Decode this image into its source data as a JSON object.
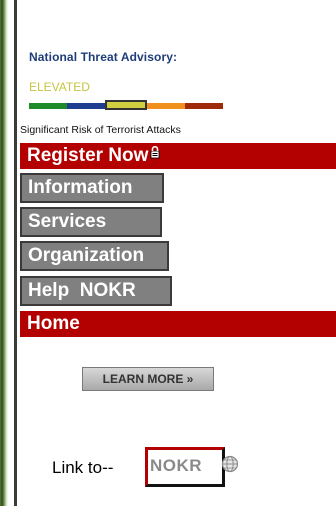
{
  "advisory": {
    "title": "National Threat Advisory:",
    "level": "ELEVATED",
    "description": "Significant Risk of Terrorist Attacks",
    "scale_colors": [
      "#1f8a2a",
      "#1f3d8f",
      "#cfcf40",
      "#f0901e",
      "#9e2a0a"
    ],
    "active_index": 2
  },
  "nav": {
    "register": "Register Now",
    "information": "Information",
    "services": "Services",
    "organization": "Organization",
    "help": "Help  NOKR",
    "home": "Home"
  },
  "learn_more": {
    "label": "LEARN MORE »"
  },
  "footer": {
    "link_text": "Link to--",
    "logo_text": "NOKR"
  },
  "colors": {
    "nav_red": "#b30000",
    "nav_gray": "#808080",
    "advisory_blue": "#1f3d78",
    "elevated_yellow": "#c7c542"
  },
  "icons": {
    "register": "lock-icon",
    "logo": "globe-icon"
  }
}
